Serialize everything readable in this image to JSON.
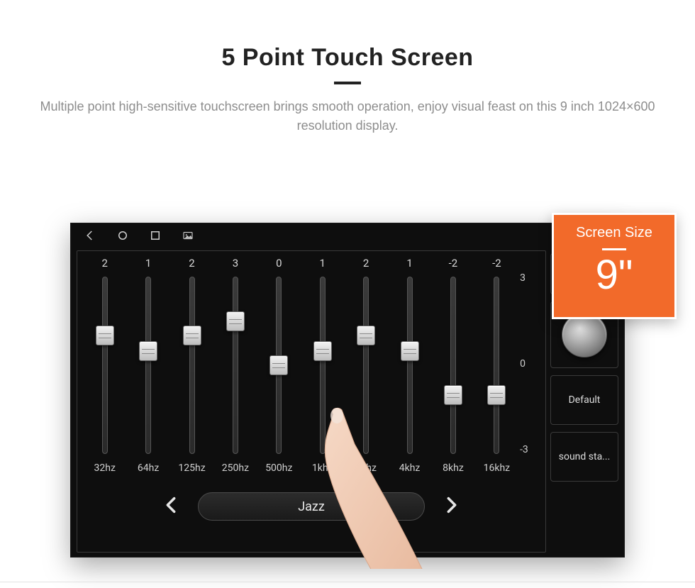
{
  "hero": {
    "title": "5 Point Touch Screen",
    "subtitle": "Multiple point high-sensitive touchscreen brings smooth operation, enjoy visual feast on this 9 inch 1024×600 resolution display."
  },
  "badge": {
    "label": "Screen Size",
    "value": "9\""
  },
  "equalizer": {
    "bands": [
      {
        "value": "2",
        "freq": "32hz",
        "pos": 33
      },
      {
        "value": "1",
        "freq": "64hz",
        "pos": 42
      },
      {
        "value": "2",
        "freq": "125hz",
        "pos": 33
      },
      {
        "value": "3",
        "freq": "250hz",
        "pos": 25
      },
      {
        "value": "0",
        "freq": "500hz",
        "pos": 50
      },
      {
        "value": "1",
        "freq": "1khz",
        "pos": 42
      },
      {
        "value": "2",
        "freq": "2khz",
        "pos": 33
      },
      {
        "value": "1",
        "freq": "4khz",
        "pos": 42
      },
      {
        "value": "-2",
        "freq": "8khz",
        "pos": 67
      },
      {
        "value": "-2",
        "freq": "16khz",
        "pos": 67
      }
    ],
    "scale_top": "3",
    "scale_mid": "0",
    "scale_bot": "-3",
    "preset": "Jazz"
  },
  "side": {
    "default_btn": "Default",
    "sound_btn": "sound sta..."
  }
}
